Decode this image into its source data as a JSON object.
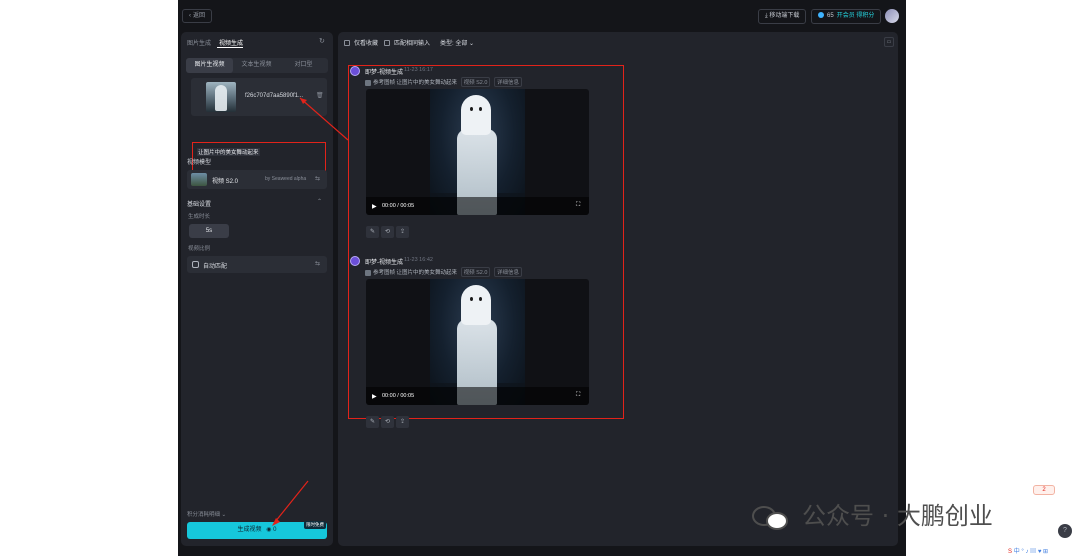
{
  "topbar": {
    "back_label": "返回",
    "download_label": "移动端下载",
    "credits": "65",
    "member_label": "开会员 得积分"
  },
  "left": {
    "tabs": [
      "图片生成",
      "视频生成"
    ],
    "subtabs": [
      "图片生视频",
      "文本生视频",
      "对口型"
    ],
    "file_name": "f26c707d7aa5890f1...",
    "prompt": "让图片中的美女舞动起来",
    "model_section": "视频模型",
    "model_name": "视频 S2.0",
    "model_by": "by Seaweed alpha",
    "settings_section": "基础设置",
    "duration_label": "生成时长",
    "duration_value": "5s",
    "ratio_label": "视频比例",
    "ratio_value": "自动匹配",
    "credit_detail": "积分消耗明细",
    "generate_label": "生成视频",
    "generate_cost": "0",
    "free_badge": "限时免费"
  },
  "main": {
    "filters": {
      "favorites": "仅看收藏",
      "matching": "匹配相同输入",
      "type": "类型: 全部"
    },
    "entries": [
      {
        "title": "即梦-视频生成",
        "time": "11-23 16:17",
        "ref_label": "参考图帧",
        "prompt": "让图片中的美女舞动起来",
        "model_chip": "视频 S2.0",
        "detail_chip": "详细信息",
        "current_time": "00:00",
        "duration": "00:05"
      },
      {
        "title": "即梦-视频生成",
        "time": "11-23 16:42",
        "ref_label": "参考图帧",
        "prompt": "让图片中的美女舞动起来",
        "model_chip": "视频 S2.0",
        "detail_chip": "详细信息",
        "current_time": "00:00",
        "duration": "00:05"
      }
    ]
  },
  "watermark": {
    "text": "公众号 · 大鹏创业"
  },
  "overlay": {
    "ime_badge": "2"
  },
  "colors": {
    "accent": "#16c7db",
    "annotation_red": "#e2231a",
    "panel": "#22242b",
    "background": "#141519"
  }
}
